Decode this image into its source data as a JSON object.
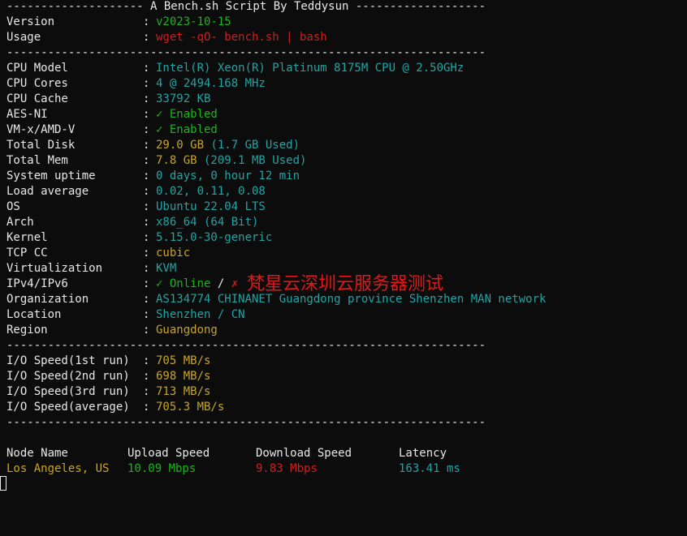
{
  "header": {
    "title_line": "-------------------- A Bench.sh Script By Teddysun -------------------"
  },
  "separator": "----------------------------------------------------------------------",
  "info": {
    "version_label": "Version",
    "version_value": "v2023-10-15",
    "usage_label": "Usage",
    "usage_value": "wget -qO- bench.sh | bash"
  },
  "system": [
    {
      "label": "CPU Model",
      "value": "Intel(R) Xeon(R) Platinum 8175M CPU @ 2.50GHz",
      "color": "cyan"
    },
    {
      "label": "CPU Cores",
      "value": "4 @ 2494.168 MHz",
      "color": "cyan"
    },
    {
      "label": "CPU Cache",
      "value": "33792 KB",
      "color": "cyan"
    },
    {
      "label": "AES-NI",
      "value": "✓ Enabled",
      "color": "green"
    },
    {
      "label": "VM-x/AMD-V",
      "value": "✓ Enabled",
      "color": "green"
    },
    {
      "label": "Total Disk",
      "value": "29.0 GB",
      "value2": " (1.7 GB Used)",
      "color": "yellow",
      "color2": "cyan"
    },
    {
      "label": "Total Mem",
      "value": "7.8 GB",
      "value2": " (209.1 MB Used)",
      "color": "yellow",
      "color2": "cyan"
    },
    {
      "label": "System uptime",
      "value": "0 days, 0 hour 12 min",
      "color": "cyan"
    },
    {
      "label": "Load average",
      "value": "0.02, 0.11, 0.08",
      "color": "cyan"
    },
    {
      "label": "OS",
      "value": "Ubuntu 22.04 LTS",
      "color": "cyan"
    },
    {
      "label": "Arch",
      "value": "x86_64 (64 Bit)",
      "color": "cyan"
    },
    {
      "label": "Kernel",
      "value": "5.15.0-30-generic",
      "color": "cyan"
    },
    {
      "label": "TCP CC",
      "value": "cubic",
      "color": "yellow"
    },
    {
      "label": "Virtualization",
      "value": "KVM",
      "color": "cyan"
    },
    {
      "label": "IPv4/IPv6",
      "value": "✓ Online",
      "value2": " / ",
      "value3": "✗",
      "color": "green",
      "color2": "white",
      "color3": "red"
    },
    {
      "label": "Organization",
      "value": "AS134774 CHINANET Guangdong province Shenzhen MAN network",
      "color": "cyan"
    },
    {
      "label": "Location",
      "value": "Shenzhen / CN",
      "color": "cyan"
    },
    {
      "label": "Region",
      "value": "Guangdong",
      "color": "yellow"
    }
  ],
  "overlay": "梵星云深圳云服务器测试",
  "io": [
    {
      "label": "I/O Speed(1st run)",
      "value": "705 MB/s"
    },
    {
      "label": "I/O Speed(2nd run)",
      "value": "698 MB/s"
    },
    {
      "label": "I/O Speed(3rd run)",
      "value": "713 MB/s"
    },
    {
      "label": "I/O Speed(average)",
      "value": "705.3 MB/s"
    }
  ],
  "speedtest": {
    "headers": [
      "Node Name",
      "Upload Speed",
      "Download Speed",
      "Latency"
    ],
    "rows": [
      {
        "node": "Los Angeles, US",
        "upload": "10.09 Mbps",
        "download": "9.83 Mbps",
        "latency": "163.41 ms"
      }
    ]
  },
  "colors": {
    "background": "#0c0c0c",
    "text": "#e8e8e8",
    "green": "#1db31d",
    "cyan": "#20a4a4",
    "yellow": "#c7a522",
    "red": "#cf1e1e"
  }
}
